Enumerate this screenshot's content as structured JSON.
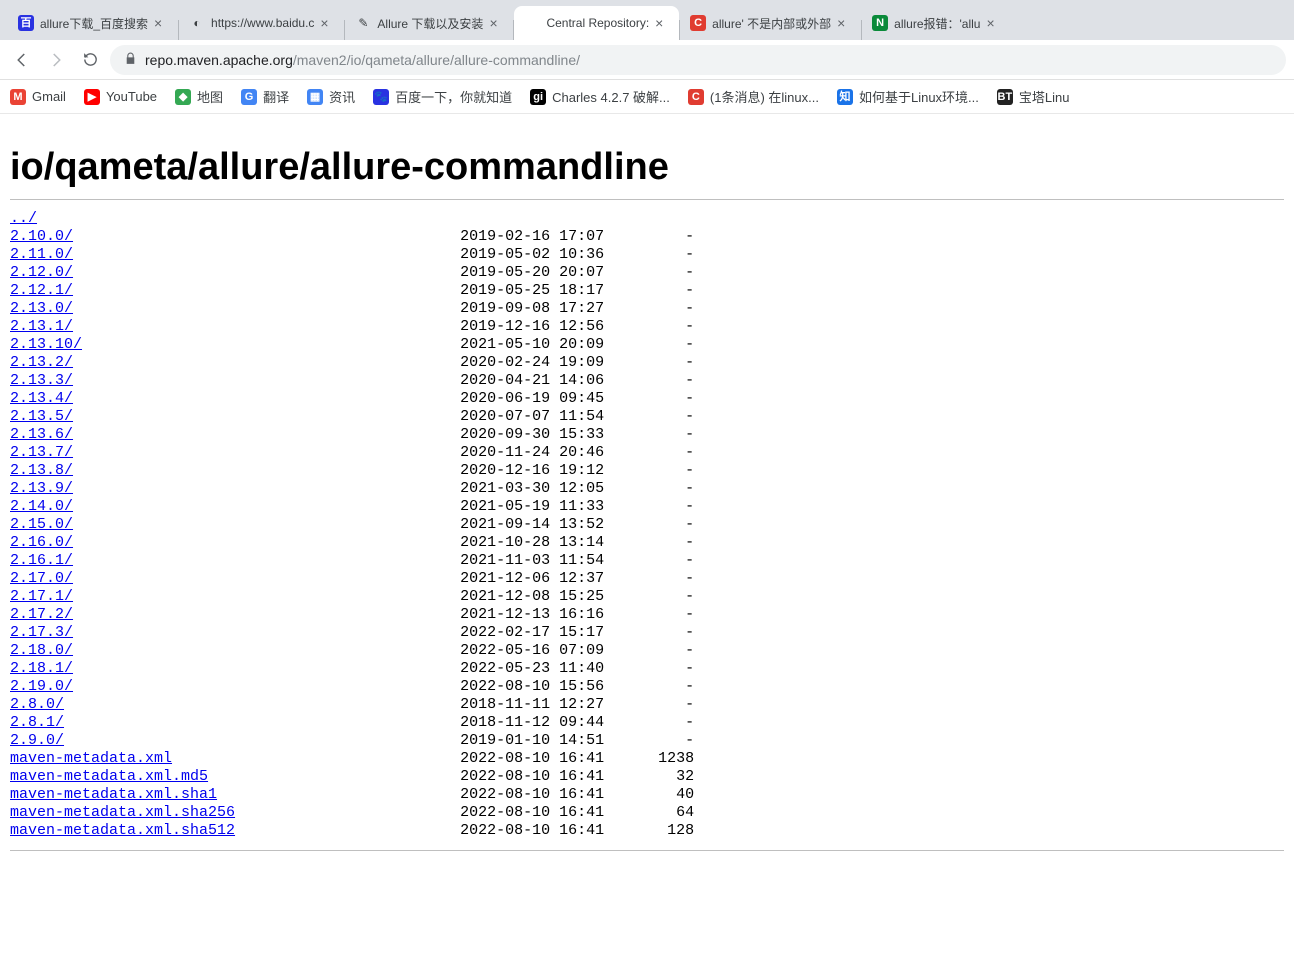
{
  "tabs": [
    {
      "title": "allure下载_百度搜索",
      "favcolor": "#2932e1",
      "fav": "百",
      "active": false
    },
    {
      "title": "https://www.baidu.c",
      "favcolor": "",
      "fav": "◐",
      "active": false,
      "loading": true
    },
    {
      "title": "Allure 下载以及安装",
      "favcolor": "",
      "fav": "✎",
      "active": false
    },
    {
      "title": "Central Repository:",
      "favcolor": "",
      "fav": "",
      "active": true
    },
    {
      "title": "allure' 不是内部或外部",
      "favcolor": "#e03c31",
      "fav": "C",
      "active": false
    },
    {
      "title": "allure报错：'allu",
      "favcolor": "#0a8a3a",
      "fav": "N",
      "active": false
    }
  ],
  "address": {
    "host": "repo.maven.apache.org",
    "path": "/maven2/io/qameta/allure/allure-commandline/"
  },
  "bookmarks": [
    {
      "label": "Gmail",
      "fav": "M",
      "color": "#ea4335"
    },
    {
      "label": "YouTube",
      "fav": "▶",
      "color": "#ff0000"
    },
    {
      "label": "地图",
      "fav": "◆",
      "color": "#34a853"
    },
    {
      "label": "翻译",
      "fav": "G",
      "color": "#4285f4"
    },
    {
      "label": "资讯",
      "fav": "▦",
      "color": "#4285f4"
    },
    {
      "label": "百度一下，你就知道",
      "fav": "🐾",
      "color": "#2932e1"
    },
    {
      "label": "Charles 4.2.7 破解...",
      "fav": "git",
      "color": "#000000"
    },
    {
      "label": "(1条消息) 在linux...",
      "fav": "C",
      "color": "#e03c31"
    },
    {
      "label": "如何基于Linux环境...",
      "fav": "知",
      "color": "#1a73e8"
    },
    {
      "label": "宝塔Linu",
      "fav": "BT",
      "color": "#222"
    }
  ],
  "heading": "io/qameta/allure/allure-commandline",
  "parent_link": "../",
  "entries": [
    {
      "name": "2.10.0/",
      "date": "2019-02-16 17:07",
      "size": "-"
    },
    {
      "name": "2.11.0/",
      "date": "2019-05-02 10:36",
      "size": "-"
    },
    {
      "name": "2.12.0/",
      "date": "2019-05-20 20:07",
      "size": "-"
    },
    {
      "name": "2.12.1/",
      "date": "2019-05-25 18:17",
      "size": "-"
    },
    {
      "name": "2.13.0/",
      "date": "2019-09-08 17:27",
      "size": "-"
    },
    {
      "name": "2.13.1/",
      "date": "2019-12-16 12:56",
      "size": "-"
    },
    {
      "name": "2.13.10/",
      "date": "2021-05-10 20:09",
      "size": "-"
    },
    {
      "name": "2.13.2/",
      "date": "2020-02-24 19:09",
      "size": "-"
    },
    {
      "name": "2.13.3/",
      "date": "2020-04-21 14:06",
      "size": "-"
    },
    {
      "name": "2.13.4/",
      "date": "2020-06-19 09:45",
      "size": "-"
    },
    {
      "name": "2.13.5/",
      "date": "2020-07-07 11:54",
      "size": "-"
    },
    {
      "name": "2.13.6/",
      "date": "2020-09-30 15:33",
      "size": "-"
    },
    {
      "name": "2.13.7/",
      "date": "2020-11-24 20:46",
      "size": "-"
    },
    {
      "name": "2.13.8/",
      "date": "2020-12-16 19:12",
      "size": "-"
    },
    {
      "name": "2.13.9/",
      "date": "2021-03-30 12:05",
      "size": "-"
    },
    {
      "name": "2.14.0/",
      "date": "2021-05-19 11:33",
      "size": "-"
    },
    {
      "name": "2.15.0/",
      "date": "2021-09-14 13:52",
      "size": "-"
    },
    {
      "name": "2.16.0/",
      "date": "2021-10-28 13:14",
      "size": "-"
    },
    {
      "name": "2.16.1/",
      "date": "2021-11-03 11:54",
      "size": "-"
    },
    {
      "name": "2.17.0/",
      "date": "2021-12-06 12:37",
      "size": "-"
    },
    {
      "name": "2.17.1/",
      "date": "2021-12-08 15:25",
      "size": "-"
    },
    {
      "name": "2.17.2/",
      "date": "2021-12-13 16:16",
      "size": "-"
    },
    {
      "name": "2.17.3/",
      "date": "2022-02-17 15:17",
      "size": "-"
    },
    {
      "name": "2.18.0/",
      "date": "2022-05-16 07:09",
      "size": "-"
    },
    {
      "name": "2.18.1/",
      "date": "2022-05-23 11:40",
      "size": "-"
    },
    {
      "name": "2.19.0/",
      "date": "2022-08-10 15:56",
      "size": "-"
    },
    {
      "name": "2.8.0/",
      "date": "2018-11-11 12:27",
      "size": "-"
    },
    {
      "name": "2.8.1/",
      "date": "2018-11-12 09:44",
      "size": "-"
    },
    {
      "name": "2.9.0/",
      "date": "2019-01-10 14:51",
      "size": "-"
    },
    {
      "name": "maven-metadata.xml",
      "date": "2022-08-10 16:41",
      "size": "1238"
    },
    {
      "name": "maven-metadata.xml.md5",
      "date": "2022-08-10 16:41",
      "size": "32"
    },
    {
      "name": "maven-metadata.xml.sha1",
      "date": "2022-08-10 16:41",
      "size": "40"
    },
    {
      "name": "maven-metadata.xml.sha256",
      "date": "2022-08-10 16:41",
      "size": "64"
    },
    {
      "name": "maven-metadata.xml.sha512",
      "date": "2022-08-10 16:41",
      "size": "128"
    }
  ],
  "listing_columns": {
    "name_width": 50,
    "date_width": 17,
    "size_width": 9
  }
}
